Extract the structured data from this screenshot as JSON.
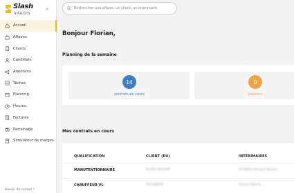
{
  "brand": {
    "name": "Slash",
    "subtitle": "interim",
    "accent": "#f2b81c"
  },
  "sidebar": {
    "collapse_glyph": "«",
    "items": [
      {
        "label": "Accueil",
        "icon": "home-icon",
        "active": true
      },
      {
        "label": "Affaires",
        "icon": "briefcase-icon"
      },
      {
        "label": "Clients",
        "icon": "building-icon"
      },
      {
        "label": "Candidats",
        "icon": "user-icon"
      },
      {
        "label": "Annonces",
        "icon": "megaphone-icon"
      },
      {
        "label": "Tâches",
        "icon": "checklist-icon"
      },
      {
        "label": "Planning",
        "icon": "calendar-icon"
      },
      {
        "label": "Heures",
        "icon": "clock-icon"
      },
      {
        "label": "Factures",
        "icon": "invoice-icon"
      },
      {
        "label": "Parrainage",
        "icon": "gift-icon"
      },
      {
        "label": "Simulateur de marges",
        "icon": "calculator-icon"
      }
    ],
    "footer": "Besoin de conseil ?"
  },
  "search": {
    "placeholder": "Rechercher une affaire, un client, un intérimaire"
  },
  "main": {
    "greeting": "Bonjour Florian,",
    "planning_title": "Planning de la semaine",
    "stats": [
      {
        "value": "14",
        "label": "contrats en cours",
        "color": "#3d7fc4"
      },
      {
        "value": "0",
        "label": "absence",
        "color": "#f0a44a"
      }
    ],
    "contracts_title": "Mes contrats en cours",
    "table": {
      "headers": [
        "QUALIFICATION",
        "CLIENT (EU)",
        "INTÉRIMAIRES"
      ],
      "rows": [
        {
          "qualification": "MANUTENTIONNAIRE",
          "client": "SLASH INTERIM",
          "worker": "AI QUÉSI Renaud Yassine"
        },
        {
          "qualification": "CHAUFFEUR VL",
          "client": "TECHNISTE",
          "worker": "Francis Djimet"
        }
      ]
    }
  }
}
